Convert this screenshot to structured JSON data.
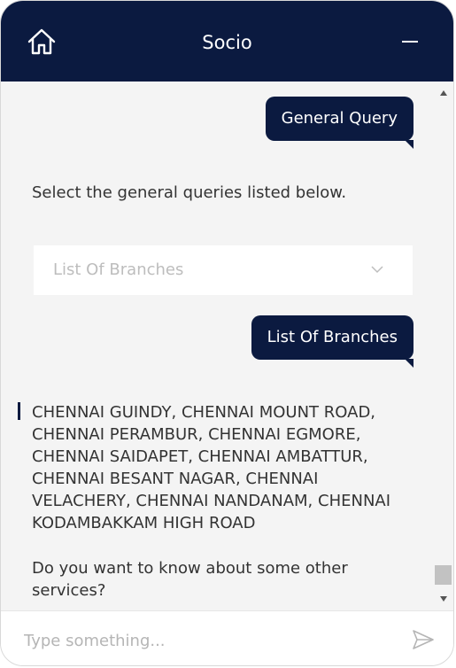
{
  "header": {
    "title": "Socio",
    "home_icon": "home-icon",
    "minimize_icon": "minimize-icon",
    "background": "#0b1a40"
  },
  "messages": {
    "user_1": "General Query",
    "bot_1": "Select the general queries listed below.",
    "select": {
      "placeholder": "List Of Branches"
    },
    "user_2": "List Of Branches",
    "bot_branches": "CHENNAI GUINDY, CHENNAI MOUNT ROAD, CHENNAI PERAMBUR, CHENNAI EGMORE, CHENNAI SAIDAPET, CHENNAI AMBATTUR, CHENNAI BESANT NAGAR, CHENNAI VELACHERY, CHENNAI NANDANAM, CHENNAI KODAMBAKKAM HIGH ROAD",
    "bot_3": "Do you want to know about some other services?"
  },
  "footer": {
    "input_placeholder": "Type something...",
    "send_icon": "send-icon"
  },
  "colors": {
    "accent": "#0b1a40",
    "chat_background": "#f4f4f4"
  }
}
